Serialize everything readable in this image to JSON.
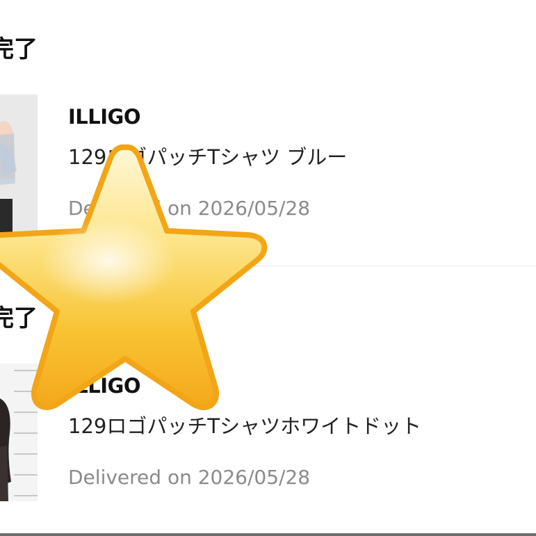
{
  "orders": [
    {
      "status_label": "完了",
      "item": {
        "brand": "ILLIGO",
        "title": "129ロゴパッチTシャツ ブルー",
        "delivery": "Delivered on 2026/05/28"
      }
    },
    {
      "status_label": "完了",
      "item": {
        "brand": "ILLIGO",
        "title": "129ロゴパッチTシャツホワイトドット",
        "delivery": "Delivered on 2026/05/28"
      }
    }
  ],
  "overlay": {
    "icon": "star-icon",
    "color": "#f7b51f"
  }
}
